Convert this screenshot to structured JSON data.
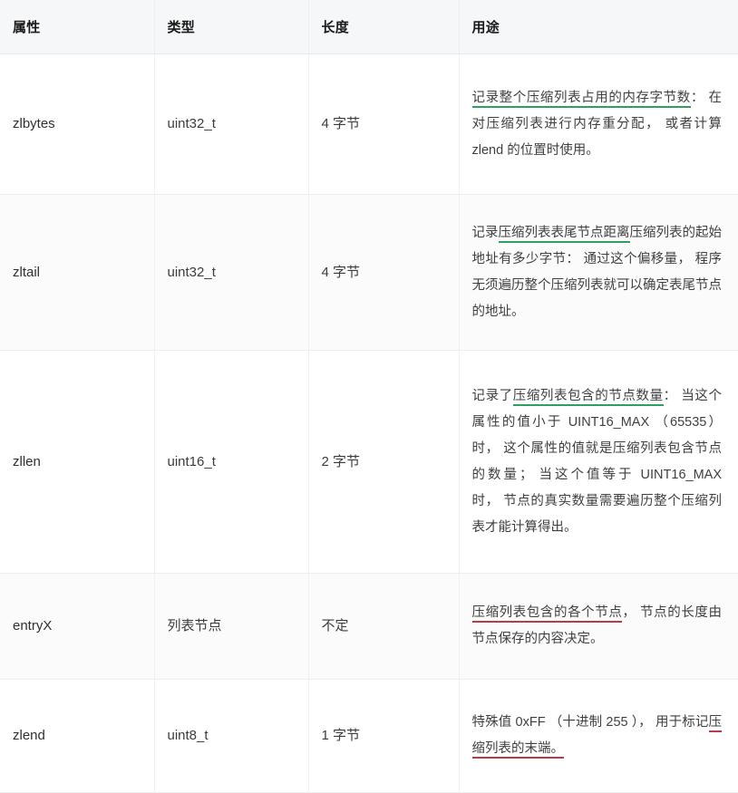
{
  "table": {
    "headers": [
      {
        "label": "属性"
      },
      {
        "label": "类型"
      },
      {
        "label": "长度"
      },
      {
        "label": "用途"
      }
    ],
    "rows": [
      {
        "attr": "zlbytes",
        "type": "uint32_t",
        "length": "4 字节",
        "use": {
          "highlight": "记录整个压缩列表占用的内存字节数",
          "highlight_color": "#2f9e5f",
          "rest": "： 在对压缩列表进行内存重分配， 或者计算 zlend 的位置时使用。"
        }
      },
      {
        "attr": "zltail",
        "type": "uint32_t",
        "length": "4 字节",
        "use": {
          "lead": "记录",
          "highlight": "压缩列表表尾节点距离",
          "highlight_color": "#2f9e5f",
          "rest": "压缩列表的起始地址有多少字节： 通过这个偏移量， 程序无须遍历整个压缩列表就可以确定表尾节点的地址。"
        }
      },
      {
        "attr": "zllen",
        "type": "uint16_t",
        "length": "2 字节",
        "use": {
          "lead": "记录了",
          "highlight": "压缩列表包含的节点数量",
          "highlight_color": "#2f9e5f",
          "rest": "： 当这个属性的值小于 UINT16_MAX （65535） 时， 这个属性的值就是压缩列表包含节点的数量； 当这个值等于 UINT16_MAX 时， 节点的真实数量需要遍历整个压缩列表才能计算得出。"
        }
      },
      {
        "attr": "entryX",
        "type": "列表节点",
        "length": "不定",
        "use": {
          "highlight": "压缩列表包含的各个节点",
          "highlight_color": "#bb3a4a",
          "rest": "， 节点的长度由节点保存的内容决定。"
        }
      },
      {
        "attr": "zlend",
        "type": "uint8_t",
        "length": "1 字节",
        "use": {
          "lead": "特殊值 0xFF （十进制 255 ）， 用于标记",
          "highlight": "压缩列表的末端。",
          "highlight_color": "#bb3a4a",
          "rest": ""
        }
      }
    ]
  },
  "colors": {
    "header_bg": "#f6f7f8",
    "row_shade_bg": "#fbfbfc",
    "row_plain_bg": "#ffffff",
    "border": "#eceef0",
    "underline_green": "#2f9e5f",
    "underline_red": "#bb3a4a",
    "text": "#3c3c3c"
  }
}
